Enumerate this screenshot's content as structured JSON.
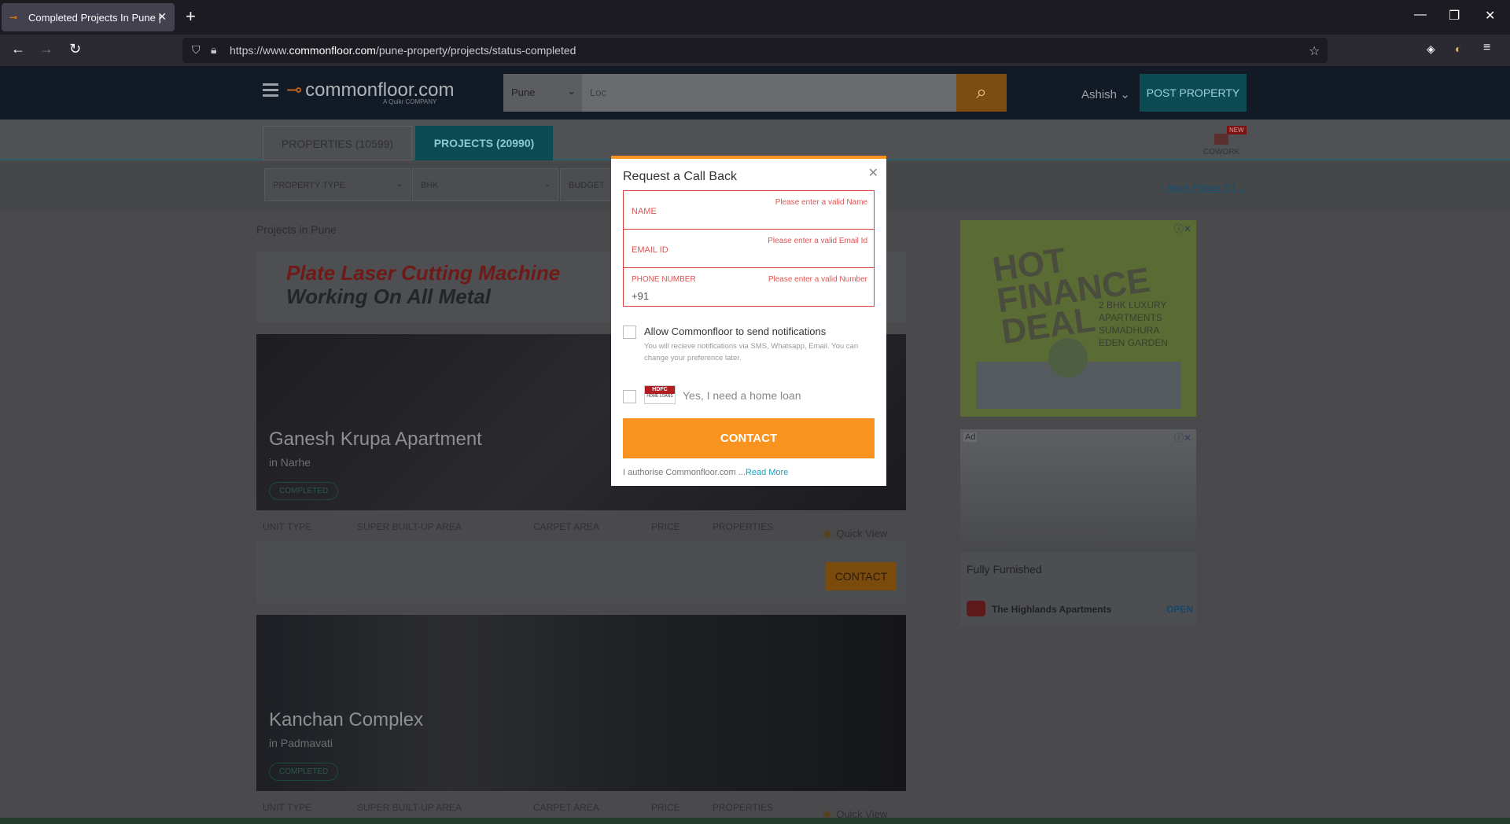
{
  "browser": {
    "tab_title": "Completed Projects In Pune | Co",
    "url_prefix": "https://www.",
    "url_domain": "commonfloor.com",
    "url_path": "/pune-property/projects/status-completed"
  },
  "header": {
    "logo_text": "commonfloor.com",
    "logo_sub": "A Quikr COMPANY",
    "city": "Pune",
    "search_placeholder": "Loc",
    "user": "Ashish",
    "post_property": "POST PROPERTY"
  },
  "tabs": {
    "properties": "PROPERTIES (10599)",
    "projects": "PROJECTS (20990)",
    "cowork": "COWORK",
    "cowork_badge": "NEW"
  },
  "filters": {
    "property_type": "PROPERTY TYPE",
    "bhk": "BHK",
    "budget": "BUDGET",
    "more_filters": "More Filters (1)"
  },
  "listing": {
    "section_title": "Projects in Pune",
    "ad_line1": "Plate Laser Cutting Machine",
    "ad_line2": "Working On All Metal",
    "columns": [
      "UNIT TYPE",
      "SUPER BUILT-UP AREA",
      "CARPET AREA",
      "PRICE",
      "PROPERTIES"
    ],
    "quick_view": "Quick View",
    "contact": "CONTACT",
    "projects": [
      {
        "name": "Ganesh Krupa Apartment",
        "location": "in Narhe",
        "status": "COMPLETED"
      },
      {
        "name": "Kanchan Complex",
        "location": "in Padmavati",
        "status": "COMPLETED"
      }
    ]
  },
  "side_ads": {
    "ad1_headline": "HOT FINANCE DEAL",
    "ad1_project": "2 BHK LUXURY APARTMENTS SUMADHURA EDEN GARDEN",
    "ad2_tag": "Ad",
    "ad2_caption": "Fully Furnished",
    "ad2_brand": "The Highlands Apartments",
    "ad2_cta": "OPEN"
  },
  "modal": {
    "title": "Request a Call Back",
    "name_label": "NAME",
    "name_error": "Please enter a valid Name",
    "email_label": "EMAIL ID",
    "email_error": "Please enter a valid Email Id",
    "phone_label": "PHONE NUMBER",
    "phone_error": "Please enter a valid Number",
    "phone_prefix": "+91",
    "notif_label": "Allow Commonfloor to send notifications",
    "notif_sub": "You will recieve notifications via SMS, Whatsapp, Email. You can change your preference later.",
    "loan_label": "Yes, I need a home loan",
    "contact_button": "CONTACT",
    "authorise_text": "I authorise Commonfloor.com ...",
    "read_more": "Read More"
  }
}
